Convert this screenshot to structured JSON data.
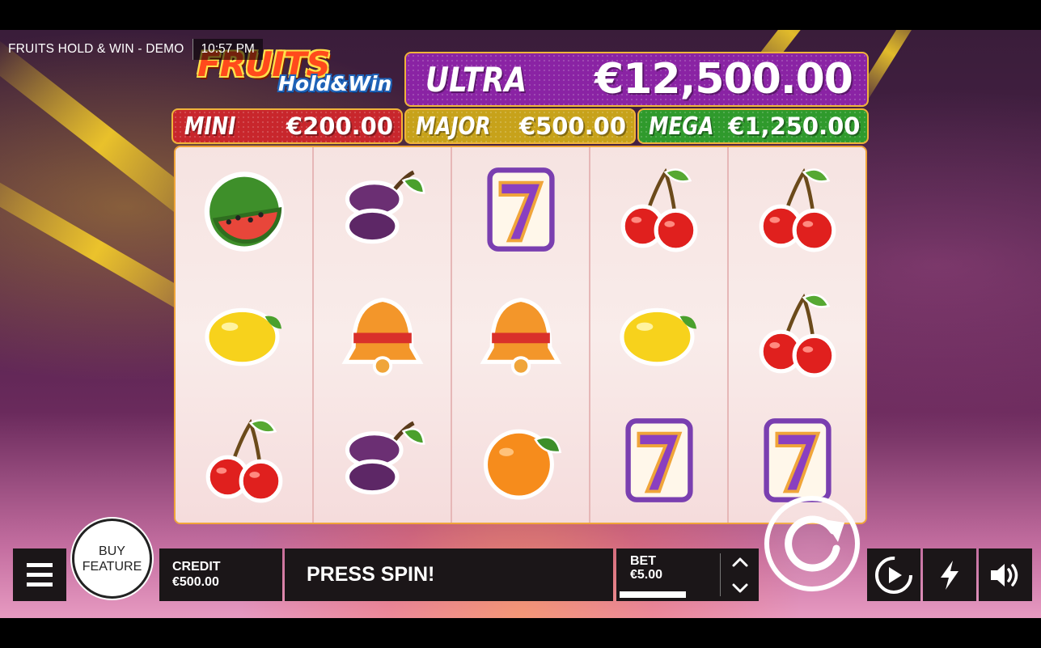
{
  "header": {
    "game_title": "FRUITS HOLD & WIN - DEMO",
    "clock": "10:57 PM"
  },
  "logo": {
    "line1": "FRUITS",
    "line2": "Hold&Win"
  },
  "jackpots": {
    "ultra": {
      "name": "ULTRA",
      "amount": "€12,500.00",
      "color": "#8a23a4"
    },
    "mini": {
      "name": "MINI",
      "amount": "€200.00",
      "color": "#c8262c"
    },
    "major": {
      "name": "MAJOR",
      "amount": "€500.00",
      "color": "#c7a21a"
    },
    "mega": {
      "name": "MEGA",
      "amount": "€1,250.00",
      "color": "#2f9a2c"
    }
  },
  "reels": [
    [
      "watermelon",
      "lemon",
      "cherry"
    ],
    [
      "plum",
      "bell",
      "plum"
    ],
    [
      "seven",
      "bell",
      "orange"
    ],
    [
      "cherry",
      "lemon",
      "seven"
    ],
    [
      "cherry",
      "cherry",
      "seven"
    ]
  ],
  "controls": {
    "menu_icon": "hamburger-icon",
    "buy_feature_label": "BUY\nFEATURE",
    "credit_label": "CREDIT",
    "credit_value": "€500.00",
    "message": "PRESS SPIN!",
    "bet_label": "BET",
    "bet_value": "€5.00",
    "bet_level_fraction": 0.5,
    "spin_icon": "spin-arrow-icon",
    "autoplay_icon": "autoplay-icon",
    "turbo_icon": "lightning-icon",
    "sound_icon": "speaker-icon"
  }
}
